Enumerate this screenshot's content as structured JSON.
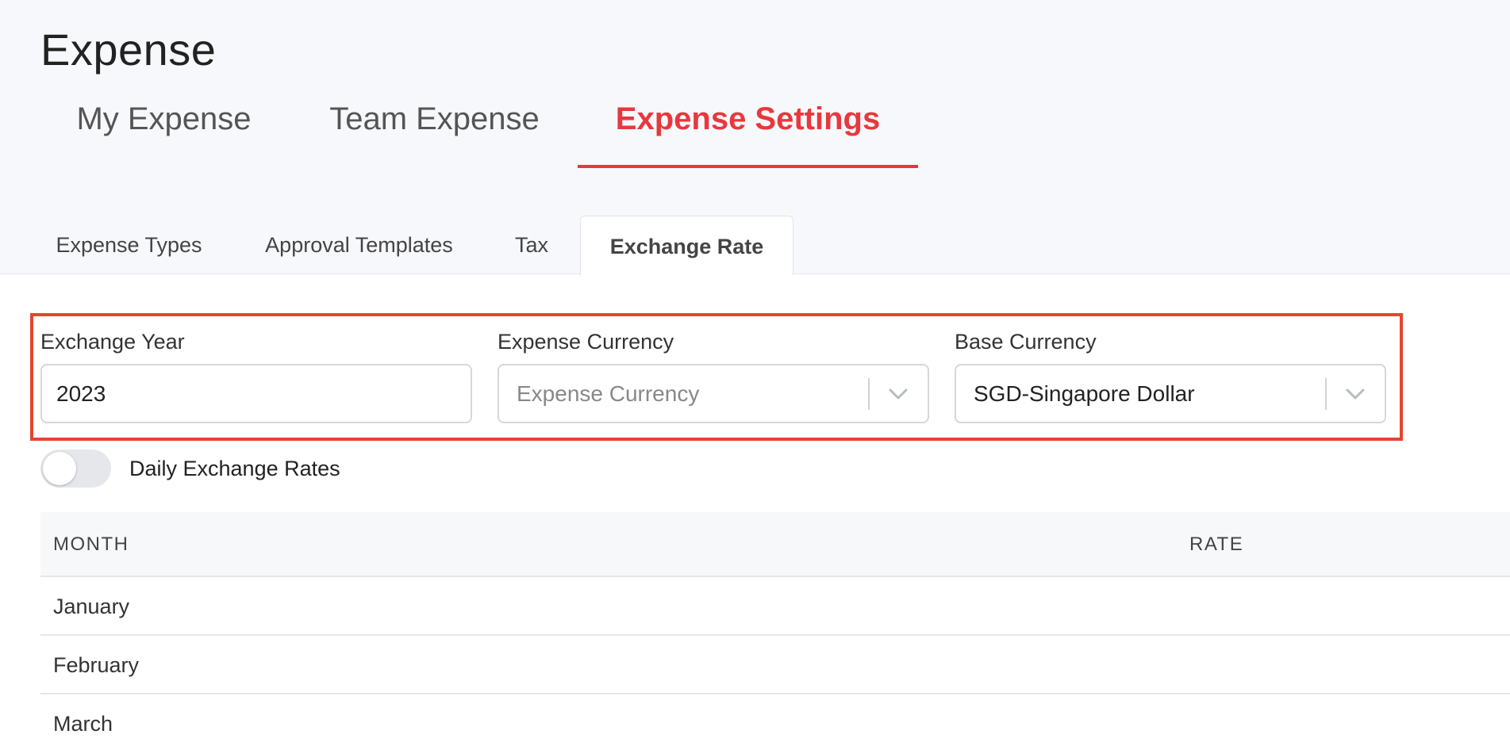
{
  "page_title": "Expense",
  "main_tabs": [
    {
      "label": "My Expense",
      "active": false
    },
    {
      "label": "Team Expense",
      "active": false
    },
    {
      "label": "Expense Settings",
      "active": true
    }
  ],
  "sub_tabs": [
    {
      "label": "Expense Types",
      "active": false
    },
    {
      "label": "Approval Templates",
      "active": false
    },
    {
      "label": "Tax",
      "active": false
    },
    {
      "label": "Exchange Rate",
      "active": true
    }
  ],
  "form": {
    "exchange_year": {
      "label": "Exchange Year",
      "value": "2023"
    },
    "expense_currency": {
      "label": "Expense Currency",
      "placeholder": "Expense Currency",
      "value": ""
    },
    "base_currency": {
      "label": "Base Currency",
      "value": "SGD-Singapore Dollar"
    }
  },
  "daily_toggle": {
    "label": "Daily Exchange Rates",
    "on": false
  },
  "table": {
    "headers": [
      "MONTH",
      "RATE"
    ],
    "rows": [
      {
        "month": "January",
        "rate": ""
      },
      {
        "month": "February",
        "rate": ""
      },
      {
        "month": "March",
        "rate": ""
      }
    ]
  },
  "colors": {
    "accent": "#e8383d",
    "highlight_border": "#e4452f",
    "header_bg": "#f7f8fb"
  },
  "icons": {
    "dropdown": "chevron-down-icon"
  }
}
